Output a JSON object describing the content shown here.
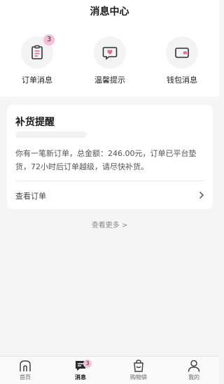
{
  "header": {
    "title": "消息中心"
  },
  "quick_actions": [
    {
      "label": "订单消息",
      "icon": "clipboard-icon",
      "badge": "3"
    },
    {
      "label": "温馨提示",
      "icon": "heart-message-icon"
    },
    {
      "label": "钱包消息",
      "icon": "wallet-icon"
    }
  ],
  "restock_card": {
    "title": "补货提醒",
    "body": "你有一笔新订单，总金额：246.00元，订单已平台垫货，72小时后订单越级，请尽快补货。",
    "link_label": "查看订单"
  },
  "more_label": "查看更多 >",
  "tabbar": {
    "items": [
      {
        "label": "首页",
        "icon": "home-icon",
        "active": false
      },
      {
        "label": "消息",
        "icon": "message-icon",
        "active": true,
        "badge": "3"
      },
      {
        "label": "购物袋",
        "icon": "shopping-bag-icon",
        "active": false
      },
      {
        "label": "我的",
        "icon": "user-icon",
        "active": false
      }
    ]
  },
  "colors": {
    "accent": "#e06a9c",
    "badge": "#f5bfd7",
    "background": "#f5f5f6"
  }
}
